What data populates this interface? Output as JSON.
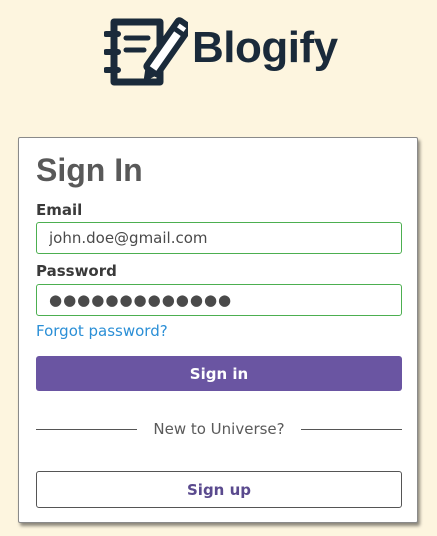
{
  "brand": {
    "name": "Blogify",
    "logo_icon": "notebook-pencil-icon",
    "color": "#1a2a3a"
  },
  "form": {
    "title": "Sign In",
    "email_label": "Email",
    "email_value": "john.doe@gmail.com",
    "password_label": "Password",
    "password_value": "●●●●●●●●●●●●●",
    "forgot_link": "Forgot password?",
    "sign_in_label": "Sign in",
    "divider_text": "New to Universe?",
    "sign_up_label": "Sign up"
  },
  "colors": {
    "background": "#fdf5df",
    "primary_button": "#6a55a2",
    "link": "#2b8fd6",
    "field_border": "#4caf50"
  }
}
